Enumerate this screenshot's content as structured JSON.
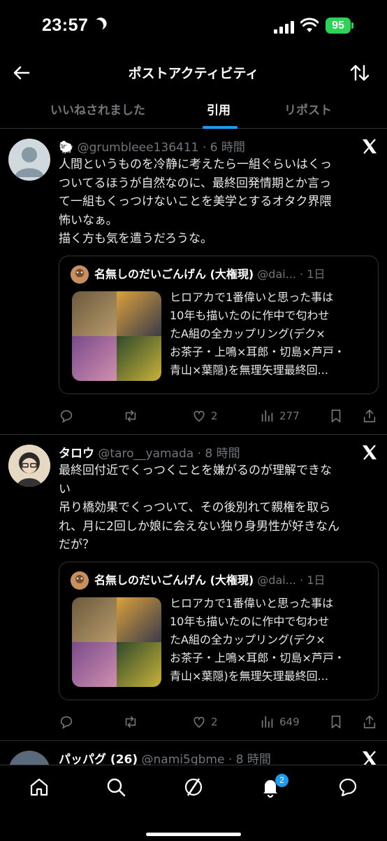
{
  "status": {
    "time": "23:57",
    "battery": "95"
  },
  "header": {
    "title": "ポストアクティビティ"
  },
  "tabs": [
    {
      "label": "いいねされました"
    },
    {
      "label": "引用"
    },
    {
      "label": "リポスト"
    }
  ],
  "tweets": [
    {
      "name": "🐑",
      "handle_time": "@grumbleee136411 · 6 時間",
      "text": "人間というものを冷静に考えたら一組ぐらいはくっ\nついてるほうが自然なのに、最終回発情期とか言っ\nて一組もくっつけないことを美学とするオタク界隈\n怖いなぁ。\n描く方も気を遣うだろうな。",
      "quote": {
        "name": "名無しのだいごんげん (大権現)",
        "handle_time": "@dai... · 1日",
        "text": "ヒロアカで1番偉いと思った事は\n10年も描いたのに作中で匂わせ\nたA組の全カップリング(デク×\nお茶子・上鳴×耳郎・切島×芦戸・\n青山×葉隠)を無理矢理最終回..."
      },
      "likes": "2",
      "views": "277"
    },
    {
      "name": "タロウ",
      "handle_time": "@taro__yamada · 8 時間",
      "text": "最終回付近でくっつくことを嫌がるのが理解できな\nい\n吊り橋効果でくっついて、その後別れて親権を取ら\nれ、月に2回しか娘に会えない独り身男性が好きなん\nだが？",
      "quote": {
        "name": "名無しのだいごんげん (大権現)",
        "handle_time": "@dai... · 1日",
        "text": "ヒロアカで1番偉いと思った事は\n10年も描いたのに作中で匂わせ\nたA組の全カップリング(デク×\nお茶子・上鳴×耳郎・切島×芦戸・\n青山×葉隠)を無理矢理最終回..."
      },
      "likes": "2",
      "views": "649"
    },
    {
      "name": "パッパグ (26)",
      "handle_time": "@nami5gbme · 8 時間"
    }
  ],
  "nav": {
    "notification_badge": "2"
  },
  "colors": {
    "accent": "#1d9bf0",
    "muted": "#71767b",
    "battery": "#30d158",
    "border": "#2f3336"
  }
}
